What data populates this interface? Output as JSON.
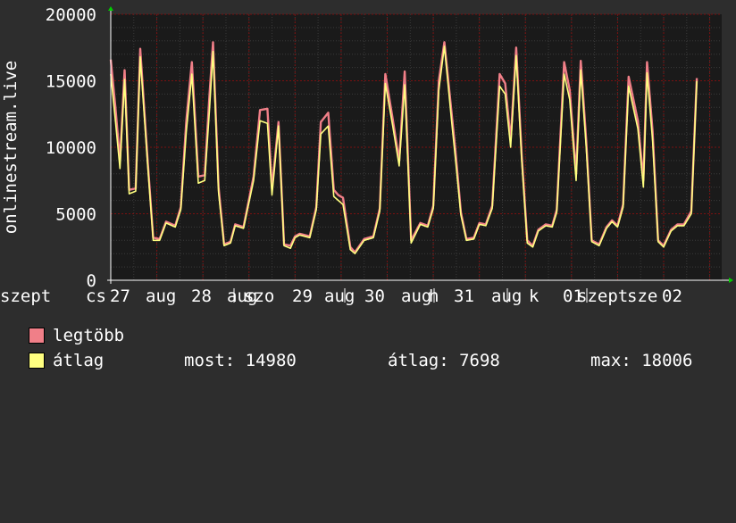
{
  "colors": {
    "background": "#2d2d2d",
    "plot_background": "#1a1a1a",
    "grid_major": "#7a1010",
    "grid_minor": "#3a3a3a",
    "axis": "#ffffff",
    "arrow": "#00cc00",
    "max_series": "#f07f88",
    "avg_series": "#ffff80"
  },
  "chart_data": {
    "type": "area",
    "ylabel": "onlinestream.live",
    "ylim": [
      0,
      20000
    ],
    "y_ticks": [
      0,
      5000,
      10000,
      15000,
      20000
    ],
    "x_tick_labels": [
      "cs",
      "27 aug",
      "28 aug",
      "szo",
      "29 aug",
      "30 aug",
      "h",
      "31 aug",
      "k",
      "01 szept",
      "sze",
      "02 szept"
    ],
    "grid": true,
    "legend_position": "bottom-left",
    "x_unit": "days",
    "x_range": [
      0,
      6.63
    ],
    "series": [
      {
        "name": "legtöbb",
        "color": "#f07f88",
        "points": [
          [
            0.0,
            16600
          ],
          [
            0.05,
            13000
          ],
          [
            0.1,
            9000
          ],
          [
            0.15,
            15800
          ],
          [
            0.2,
            6800
          ],
          [
            0.27,
            6900
          ],
          [
            0.32,
            17400
          ],
          [
            0.4,
            9000
          ],
          [
            0.46,
            3200
          ],
          [
            0.53,
            3100
          ],
          [
            0.6,
            4400
          ],
          [
            0.7,
            4100
          ],
          [
            0.76,
            5500
          ],
          [
            0.82,
            12000
          ],
          [
            0.88,
            16400
          ],
          [
            0.95,
            7800
          ],
          [
            1.02,
            7900
          ],
          [
            1.07,
            13800
          ],
          [
            1.11,
            17900
          ],
          [
            1.17,
            7000
          ],
          [
            1.23,
            2700
          ],
          [
            1.3,
            2900
          ],
          [
            1.35,
            4200
          ],
          [
            1.44,
            4000
          ],
          [
            1.55,
            7800
          ],
          [
            1.62,
            12800
          ],
          [
            1.7,
            12900
          ],
          [
            1.75,
            6900
          ],
          [
            1.82,
            11900
          ],
          [
            1.88,
            2700
          ],
          [
            1.95,
            2600
          ],
          [
            2.0,
            3300
          ],
          [
            2.05,
            3500
          ],
          [
            2.16,
            3300
          ],
          [
            2.23,
            5500
          ],
          [
            2.28,
            11900
          ],
          [
            2.36,
            12600
          ],
          [
            2.42,
            6800
          ],
          [
            2.47,
            6400
          ],
          [
            2.52,
            6200
          ],
          [
            2.6,
            2500
          ],
          [
            2.65,
            2100
          ],
          [
            2.75,
            3100
          ],
          [
            2.85,
            3300
          ],
          [
            2.92,
            5400
          ],
          [
            2.98,
            15500
          ],
          [
            3.06,
            12100
          ],
          [
            3.13,
            9000
          ],
          [
            3.19,
            15700
          ],
          [
            3.26,
            3000
          ],
          [
            3.36,
            4300
          ],
          [
            3.44,
            4100
          ],
          [
            3.5,
            5600
          ],
          [
            3.56,
            15000
          ],
          [
            3.62,
            17900
          ],
          [
            3.7,
            12500
          ],
          [
            3.74,
            9800
          ],
          [
            3.8,
            5100
          ],
          [
            3.86,
            3100
          ],
          [
            3.94,
            3200
          ],
          [
            4.0,
            4300
          ],
          [
            4.07,
            4200
          ],
          [
            4.14,
            5600
          ],
          [
            4.22,
            15500
          ],
          [
            4.28,
            14800
          ],
          [
            4.34,
            10500
          ],
          [
            4.4,
            17500
          ],
          [
            4.46,
            9400
          ],
          [
            4.52,
            3000
          ],
          [
            4.58,
            2600
          ],
          [
            4.64,
            3800
          ],
          [
            4.72,
            4200
          ],
          [
            4.79,
            4100
          ],
          [
            4.84,
            5300
          ],
          [
            4.92,
            16400
          ],
          [
            4.98,
            14300
          ],
          [
            5.05,
            8000
          ],
          [
            5.1,
            16500
          ],
          [
            5.16,
            10500
          ],
          [
            5.22,
            3000
          ],
          [
            5.3,
            2700
          ],
          [
            5.38,
            4000
          ],
          [
            5.44,
            4500
          ],
          [
            5.5,
            4100
          ],
          [
            5.56,
            5700
          ],
          [
            5.62,
            15300
          ],
          [
            5.72,
            12000
          ],
          [
            5.78,
            7500
          ],
          [
            5.82,
            16400
          ],
          [
            5.88,
            11200
          ],
          [
            5.94,
            3000
          ],
          [
            6.0,
            2600
          ],
          [
            6.08,
            3800
          ],
          [
            6.15,
            4200
          ],
          [
            6.22,
            4200
          ],
          [
            6.3,
            5200
          ],
          [
            6.36,
            15200
          ]
        ]
      },
      {
        "name": "átlag",
        "color": "#ffff80",
        "points": [
          [
            0.0,
            15500
          ],
          [
            0.05,
            12000
          ],
          [
            0.1,
            8400
          ],
          [
            0.15,
            15100
          ],
          [
            0.2,
            6500
          ],
          [
            0.27,
            6700
          ],
          [
            0.32,
            16800
          ],
          [
            0.4,
            8700
          ],
          [
            0.46,
            3000
          ],
          [
            0.53,
            3000
          ],
          [
            0.6,
            4300
          ],
          [
            0.7,
            4000
          ],
          [
            0.76,
            5300
          ],
          [
            0.82,
            11200
          ],
          [
            0.88,
            15500
          ],
          [
            0.95,
            7300
          ],
          [
            1.02,
            7500
          ],
          [
            1.07,
            12700
          ],
          [
            1.11,
            17200
          ],
          [
            1.17,
            6600
          ],
          [
            1.23,
            2600
          ],
          [
            1.3,
            2800
          ],
          [
            1.35,
            4100
          ],
          [
            1.44,
            3900
          ],
          [
            1.55,
            7500
          ],
          [
            1.62,
            12000
          ],
          [
            1.7,
            11800
          ],
          [
            1.75,
            6400
          ],
          [
            1.82,
            11600
          ],
          [
            1.88,
            2600
          ],
          [
            1.95,
            2400
          ],
          [
            2.0,
            3200
          ],
          [
            2.05,
            3400
          ],
          [
            2.16,
            3200
          ],
          [
            2.23,
            5300
          ],
          [
            2.28,
            11000
          ],
          [
            2.36,
            11600
          ],
          [
            2.42,
            6300
          ],
          [
            2.47,
            6000
          ],
          [
            2.52,
            5700
          ],
          [
            2.6,
            2300
          ],
          [
            2.65,
            2000
          ],
          [
            2.75,
            3000
          ],
          [
            2.85,
            3200
          ],
          [
            2.92,
            5200
          ],
          [
            2.98,
            14800
          ],
          [
            3.06,
            11600
          ],
          [
            3.13,
            8600
          ],
          [
            3.19,
            14700
          ],
          [
            3.26,
            2800
          ],
          [
            3.36,
            4200
          ],
          [
            3.44,
            4000
          ],
          [
            3.5,
            5400
          ],
          [
            3.56,
            14300
          ],
          [
            3.62,
            17600
          ],
          [
            3.7,
            11900
          ],
          [
            3.74,
            9200
          ],
          [
            3.8,
            4900
          ],
          [
            3.86,
            3000
          ],
          [
            3.94,
            3100
          ],
          [
            4.0,
            4200
          ],
          [
            4.07,
            4100
          ],
          [
            4.14,
            5400
          ],
          [
            4.22,
            14600
          ],
          [
            4.28,
            14000
          ],
          [
            4.34,
            10000
          ],
          [
            4.4,
            16900
          ],
          [
            4.46,
            9000
          ],
          [
            4.52,
            2800
          ],
          [
            4.58,
            2500
          ],
          [
            4.64,
            3700
          ],
          [
            4.72,
            4100
          ],
          [
            4.79,
            4000
          ],
          [
            4.84,
            5100
          ],
          [
            4.92,
            15500
          ],
          [
            4.98,
            13600
          ],
          [
            5.05,
            7500
          ],
          [
            5.1,
            15800
          ],
          [
            5.16,
            10000
          ],
          [
            5.22,
            2900
          ],
          [
            5.3,
            2600
          ],
          [
            5.38,
            3900
          ],
          [
            5.44,
            4400
          ],
          [
            5.5,
            4000
          ],
          [
            5.56,
            5500
          ],
          [
            5.62,
            14600
          ],
          [
            5.72,
            11400
          ],
          [
            5.78,
            7000
          ],
          [
            5.82,
            15600
          ],
          [
            5.88,
            10500
          ],
          [
            5.94,
            2900
          ],
          [
            6.0,
            2500
          ],
          [
            6.08,
            3700
          ],
          [
            6.15,
            4100
          ],
          [
            6.22,
            4100
          ],
          [
            6.3,
            5000
          ],
          [
            6.36,
            14980
          ]
        ]
      }
    ]
  },
  "legend": {
    "items": [
      {
        "label": "legtöbb",
        "color": "#f07f88"
      },
      {
        "label": "átlag",
        "color": "#ffff80"
      }
    ],
    "stats": {
      "current": "most: 14980",
      "average": "átlag: 7698",
      "maximum": "max: 18006"
    }
  }
}
